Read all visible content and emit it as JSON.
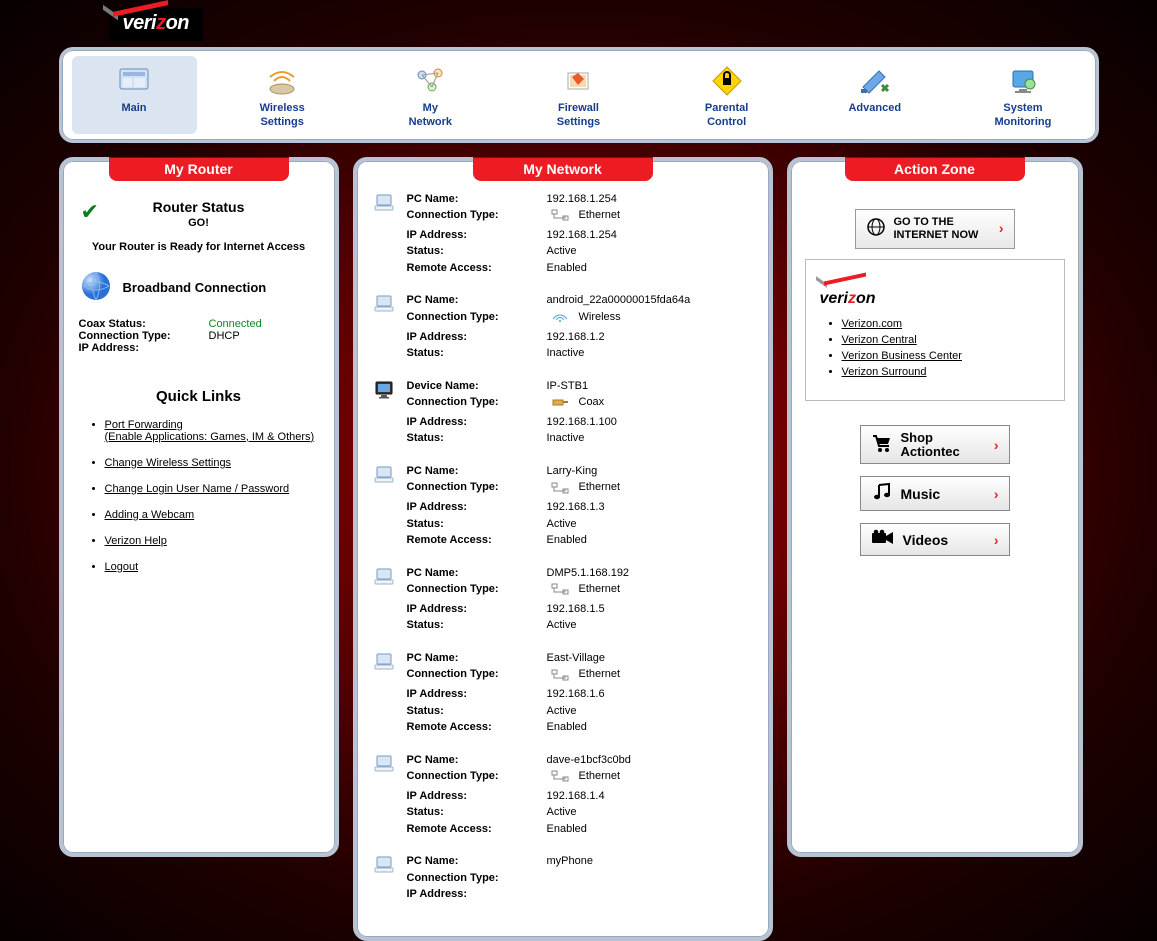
{
  "brand": "verizon",
  "nav": [
    {
      "label": "Main",
      "active": true
    },
    {
      "label": "Wireless Settings",
      "active": false
    },
    {
      "label": "My Network",
      "active": false
    },
    {
      "label": "Firewall Settings",
      "active": false
    },
    {
      "label": "Parental Control",
      "active": false
    },
    {
      "label": "Advanced",
      "active": false
    },
    {
      "label": "System Monitoring",
      "active": false
    }
  ],
  "panels": {
    "left_title": "My Router",
    "mid_title": "My Network",
    "right_title": "Action Zone"
  },
  "router_status": {
    "title": "Router Status",
    "go": "GO!",
    "message": "Your Router is Ready for Internet Access"
  },
  "broadband": {
    "title": "Broadband Connection",
    "fields": {
      "coax_label": "Coax Status:",
      "coax_value": "Connected",
      "conn_label": "Connection Type:",
      "conn_value": "DHCP",
      "ip_label": "IP Address:",
      "ip_value": ""
    }
  },
  "quick_links": {
    "title": "Quick Links",
    "items": [
      {
        "label": "Port Forwarding",
        "sub": "(Enable Applications: Games, IM & Others)"
      },
      {
        "label": "Change Wireless Settings"
      },
      {
        "label": "Change Login User Name / Password"
      },
      {
        "label": "Adding a Webcam"
      },
      {
        "label": "Verizon Help"
      },
      {
        "label": "Logout"
      }
    ]
  },
  "device_labels": {
    "pc_name": "PC Name:",
    "device_name": "Device Name:",
    "conn_type": "Connection Type:",
    "ip": "IP Address:",
    "status": "Status:",
    "remote": "Remote Access:"
  },
  "devices": [
    {
      "name_label": "pc_name",
      "name": "192.168.1.254",
      "conn": "Ethernet",
      "ip": "192.168.1.254",
      "status": "Active",
      "remote": "Enabled",
      "icon": "laptop"
    },
    {
      "name_label": "pc_name",
      "name": "android_22a00000015fda64a",
      "conn": "Wireless",
      "ip": "192.168.1.2",
      "status": "Inactive",
      "icon": "laptop"
    },
    {
      "name_label": "device_name",
      "name": "IP-STB1",
      "conn": "Coax",
      "ip": "192.168.1.100",
      "status": "Inactive",
      "icon": "monitor"
    },
    {
      "name_label": "pc_name",
      "name": "Larry-King",
      "conn": "Ethernet",
      "ip": "192.168.1.3",
      "status": "Active",
      "remote": "Enabled",
      "icon": "laptop"
    },
    {
      "name_label": "pc_name",
      "name": "DMP5.1.168.192",
      "conn": "Ethernet",
      "ip": "192.168.1.5",
      "status": "Active",
      "icon": "laptop"
    },
    {
      "name_label": "pc_name",
      "name": "East-Village",
      "conn": "Ethernet",
      "ip": "192.168.1.6",
      "status": "Active",
      "remote": "Enabled",
      "icon": "laptop"
    },
    {
      "name_label": "pc_name",
      "name": "dave-e1bcf3c0bd",
      "conn": "Ethernet",
      "ip": "192.168.1.4",
      "status": "Active",
      "remote": "Enabled",
      "icon": "laptop"
    },
    {
      "name_label": "pc_name",
      "name": "myPhone",
      "conn": "",
      "ip": "",
      "status": "",
      "icon": "laptop"
    }
  ],
  "action_zone": {
    "go_internet": "GO TO THE INTERNET NOW",
    "links": [
      "Verizon.com",
      "Verizon Central",
      "Verizon Business Center",
      "Verizon Surround"
    ],
    "buttons": [
      {
        "line1": "Shop",
        "line2": "Actiontec",
        "icon": "cart"
      },
      {
        "line1": "Music",
        "icon": "music"
      },
      {
        "line1": "Videos",
        "icon": "video"
      }
    ]
  }
}
